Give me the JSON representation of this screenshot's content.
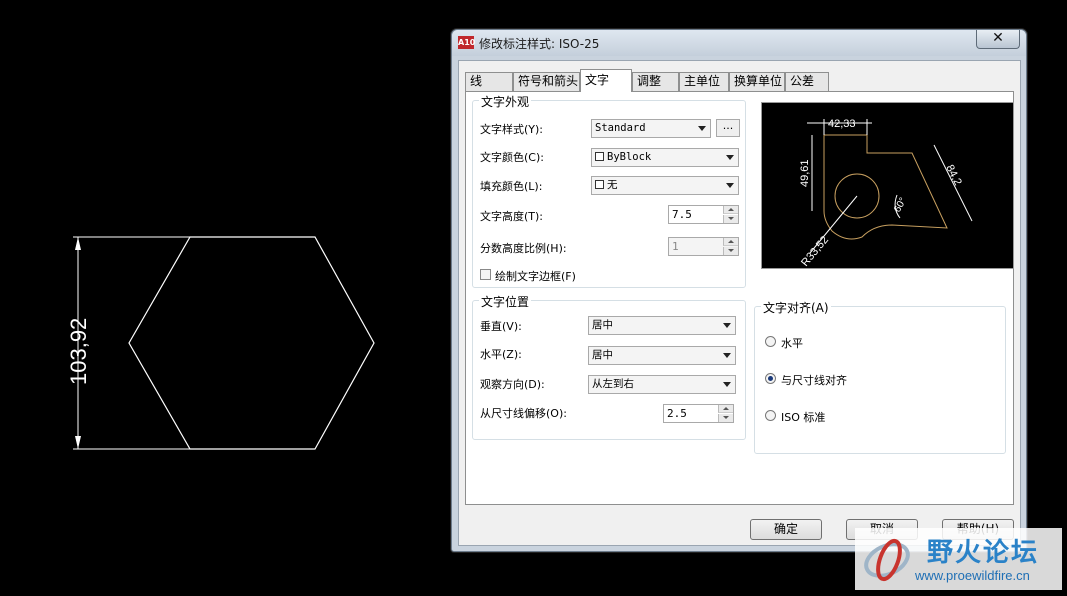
{
  "cad": {
    "dimension_text": "103,92"
  },
  "dialog": {
    "title": "修改标注样式: ISO-25",
    "app_icon_text": "A10",
    "close_glyph": "✕",
    "tabs": [
      {
        "label": "线"
      },
      {
        "label": "符号和箭头"
      },
      {
        "label": "文字"
      },
      {
        "label": "调整"
      },
      {
        "label": "主单位"
      },
      {
        "label": "换算单位"
      },
      {
        "label": "公差"
      }
    ],
    "active_tab": "文字",
    "text_appearance": {
      "title": "文字外观",
      "style_label": "文字样式(Y):",
      "style_value": "Standard",
      "style_button": "...",
      "color_label": "文字颜色(C):",
      "color_value": "ByBlock",
      "fill_label": "填充颜色(L):",
      "fill_value": "无",
      "height_label": "文字高度(T):",
      "height_value": "7.5",
      "fraction_label": "分数高度比例(H):",
      "fraction_value": "1",
      "frame_label": "绘制文字边框(F)"
    },
    "text_placement": {
      "title": "文字位置",
      "vertical_label": "垂直(V):",
      "vertical_value": "居中",
      "horizontal_label": "水平(Z):",
      "horizontal_value": "居中",
      "direction_label": "观察方向(D):",
      "direction_value": "从左到右",
      "offset_label": "从尺寸线偏移(O):",
      "offset_value": "2.5"
    },
    "alignment": {
      "title": "文字对齐(A)",
      "options": [
        {
          "label": "水平",
          "selected": false
        },
        {
          "label": "与尺寸线对齐",
          "selected": true
        },
        {
          "label": "ISO 标准",
          "selected": false
        }
      ]
    },
    "preview": {
      "dim_top": "42,33",
      "dim_left": "49,61",
      "dim_right": "84,2",
      "dim_angle": "60°",
      "dim_radius": "R33,52"
    },
    "buttons": {
      "ok": "确定",
      "cancel": "取消",
      "help": "帮助(H)"
    }
  },
  "watermark": {
    "name": "野火论坛",
    "url": "www.proewildfire.cn"
  },
  "colors": {
    "cad_line": "#ffffff",
    "preview_geom": "#c8a060",
    "annotation": "#d42020"
  }
}
